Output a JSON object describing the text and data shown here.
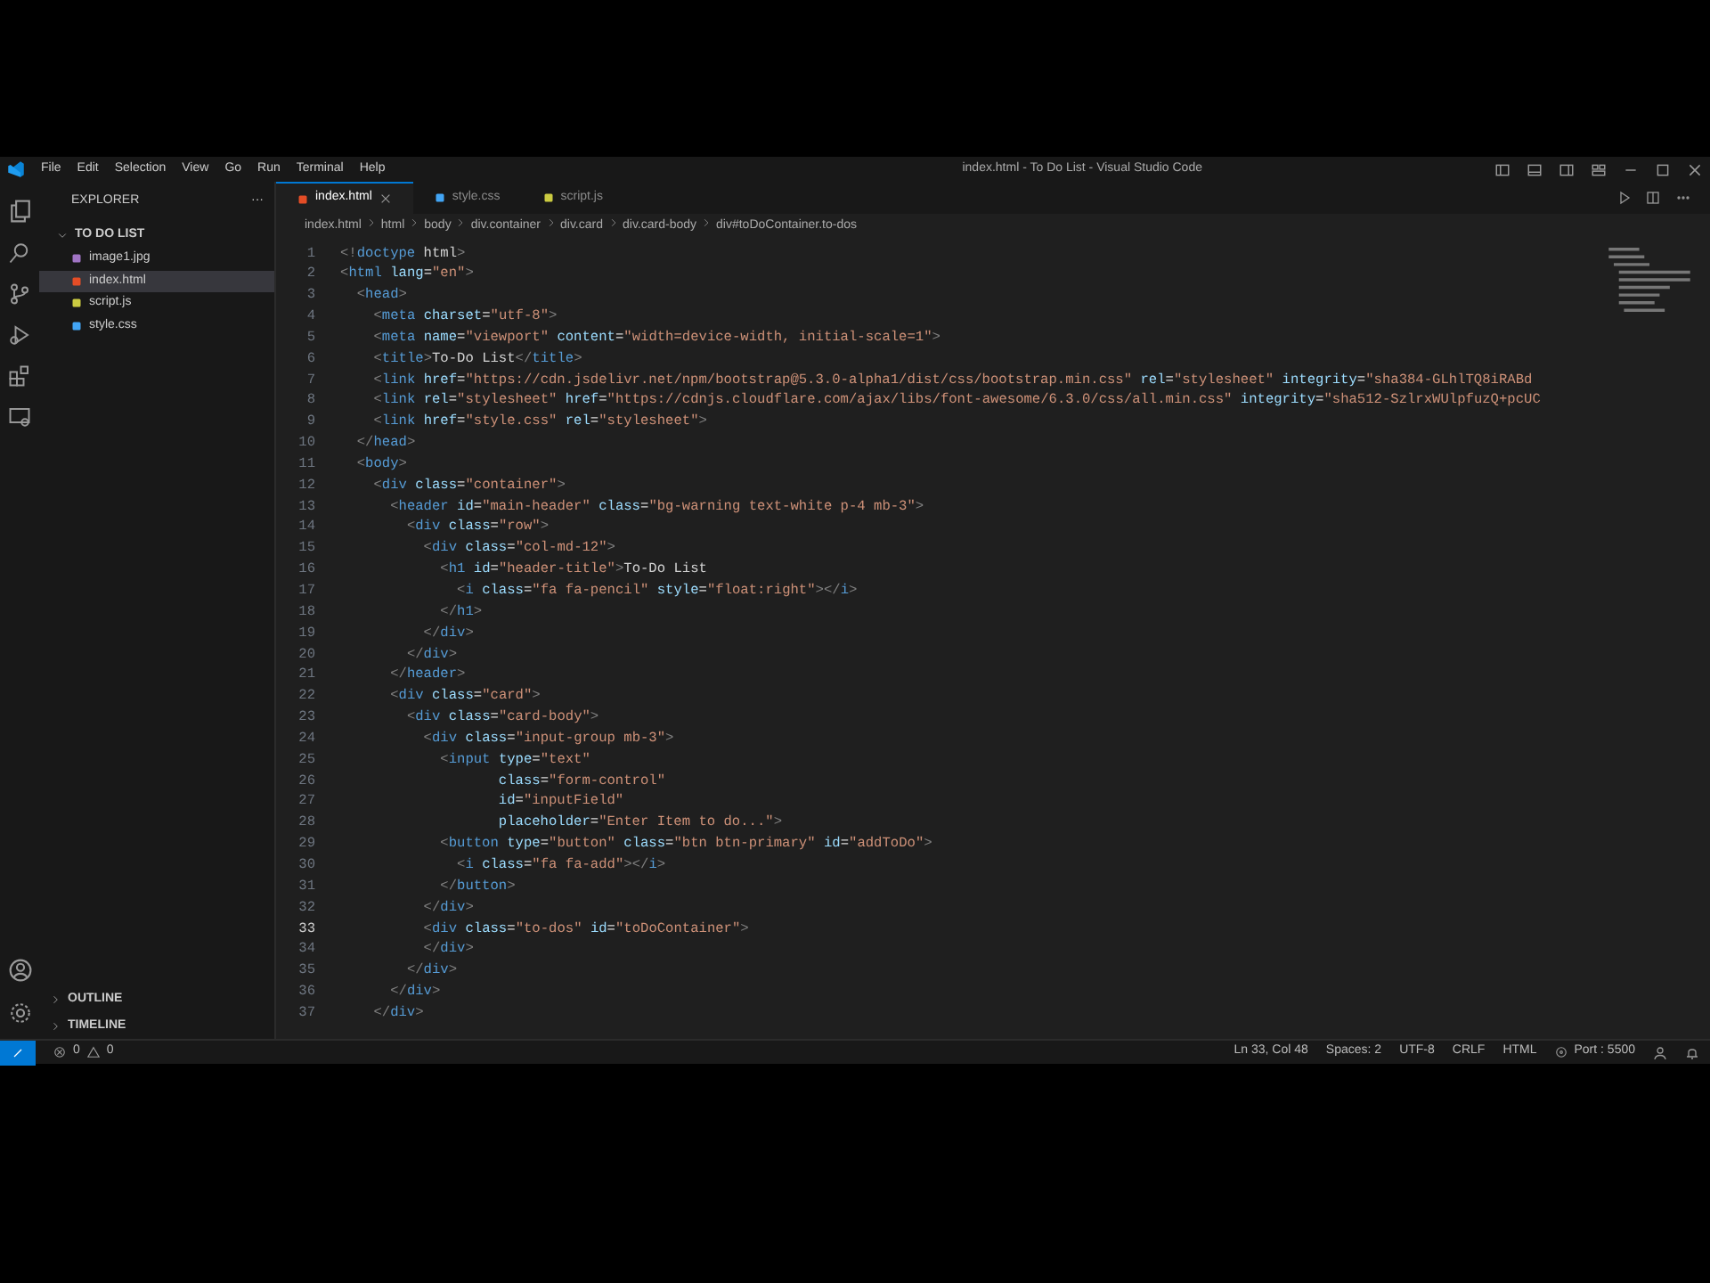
{
  "window": {
    "title": "index.html - To Do List - Visual Studio Code"
  },
  "menu": [
    "File",
    "Edit",
    "Selection",
    "View",
    "Go",
    "Run",
    "Terminal",
    "Help"
  ],
  "sidebar": {
    "title": "EXPLORER",
    "more": "···",
    "folder": {
      "name": "TO DO LIST",
      "expanded": true,
      "files": [
        {
          "name": "image1.jpg",
          "kind": "image",
          "selected": false
        },
        {
          "name": "index.html",
          "kind": "html",
          "selected": true
        },
        {
          "name": "script.js",
          "kind": "js",
          "selected": false
        },
        {
          "name": "style.css",
          "kind": "css",
          "selected": false
        }
      ]
    },
    "sections": [
      {
        "name": "OUTLINE",
        "expanded": false
      },
      {
        "name": "TIMELINE",
        "expanded": false
      }
    ]
  },
  "tabs": [
    {
      "label": "index.html",
      "kind": "html",
      "selected": true
    },
    {
      "label": "style.css",
      "kind": "css",
      "selected": false
    },
    {
      "label": "script.js",
      "kind": "js",
      "selected": false
    }
  ],
  "breadcrumbs": [
    "index.html",
    "html",
    "body",
    "div.container",
    "div.card",
    "div.card-body",
    "div#toDoContainer.to-dos"
  ],
  "editor": {
    "lines": [
      {
        "number": "1",
        "text": "<!doctype html>",
        "current": false
      },
      {
        "number": "2",
        "text": "<html lang=\"en\">",
        "current": false
      },
      {
        "number": "3",
        "text": "  <head>",
        "current": false
      },
      {
        "number": "4",
        "text": "    <meta charset=\"utf-8\">",
        "current": false
      },
      {
        "number": "5",
        "text": "    <meta name=\"viewport\" content=\"width=device-width, initial-scale=1\">",
        "current": false
      },
      {
        "number": "6",
        "text": "    <title>To-Do List</title>",
        "current": false
      },
      {
        "number": "7",
        "text": "    <link href=\"https://cdn.jsdelivr.net/npm/bootstrap@5.3.0-alpha1/dist/css/bootstrap.min.css\" rel=\"stylesheet\" integrity=\"sha384-GLhlTQ8iRABd",
        "current": false
      },
      {
        "number": "8",
        "text": "    <link rel=\"stylesheet\" href=\"https://cdnjs.cloudflare.com/ajax/libs/font-awesome/6.3.0/css/all.min.css\" integrity=\"sha512-SzlrxWUlpfuzQ+pcUC",
        "current": false
      },
      {
        "number": "9",
        "text": "    <link href=\"style.css\" rel=\"stylesheet\">",
        "current": false
      },
      {
        "number": "10",
        "text": "  </head>",
        "current": false
      },
      {
        "number": "11",
        "text": "  <body>",
        "current": false
      },
      {
        "number": "12",
        "text": "    <div class=\"container\">",
        "current": false
      },
      {
        "number": "13",
        "text": "      <header id=\"main-header\" class=\"bg-warning text-white p-4 mb-3\">",
        "current": false
      },
      {
        "number": "14",
        "text": "        <div class=\"row\">",
        "current": false
      },
      {
        "number": "15",
        "text": "          <div class=\"col-md-12\">",
        "current": false
      },
      {
        "number": "16",
        "text": "            <h1 id=\"header-title\">To-Do List",
        "current": false
      },
      {
        "number": "17",
        "text": "              <i class=\"fa fa-pencil\" style=\"float:right\"></i>",
        "current": false
      },
      {
        "number": "18",
        "text": "            </h1>",
        "current": false
      },
      {
        "number": "19",
        "text": "          </div>",
        "current": false
      },
      {
        "number": "20",
        "text": "        </div>",
        "current": false
      },
      {
        "number": "21",
        "text": "      </header>",
        "current": false
      },
      {
        "number": "22",
        "text": "      <div class=\"card\">",
        "current": false
      },
      {
        "number": "23",
        "text": "        <div class=\"card-body\">",
        "current": false
      },
      {
        "number": "24",
        "text": "          <div class=\"input-group mb-3\">",
        "current": false
      },
      {
        "number": "25",
        "text": "            <input type=\"text\"",
        "current": false
      },
      {
        "number": "26",
        "text": "                   class=\"form-control\"",
        "current": false
      },
      {
        "number": "27",
        "text": "                   id=\"inputField\"",
        "current": false
      },
      {
        "number": "28",
        "text": "                   placeholder=\"Enter Item to do...\">",
        "current": false
      },
      {
        "number": "29",
        "text": "            <button type=\"button\" class=\"btn btn-primary\" id=\"addToDo\">",
        "current": false
      },
      {
        "number": "30",
        "text": "              <i class=\"fa fa-add\"></i>",
        "current": false
      },
      {
        "number": "31",
        "text": "            </button>",
        "current": false
      },
      {
        "number": "32",
        "text": "          </div>",
        "current": false
      },
      {
        "number": "33",
        "text": "          <div class=\"to-dos\" id=\"toDoContainer\">",
        "current": true
      },
      {
        "number": "34",
        "text": "          </div>",
        "current": false
      },
      {
        "number": "35",
        "text": "        </div>",
        "current": false
      },
      {
        "number": "36",
        "text": "      </div>",
        "current": false
      },
      {
        "number": "37",
        "text": "    </div>",
        "current": false
      }
    ]
  },
  "status_bar": {
    "errors": "0",
    "warnings": "0",
    "items": [
      "Ln 33, Col 48",
      "Spaces: 2",
      "UTF-8",
      "CRLF",
      "HTML"
    ],
    "port": "Port : 5500"
  }
}
